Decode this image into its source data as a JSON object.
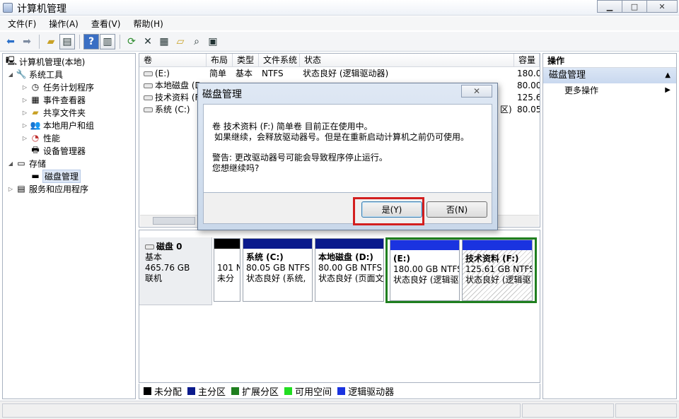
{
  "window": {
    "title": "计算机管理",
    "minimize": "▁",
    "maximize": "□",
    "close": "✕"
  },
  "menu": [
    "文件(F)",
    "操作(A)",
    "查看(V)",
    "帮助(H)"
  ],
  "toolbar_icons": [
    "back-arrow-icon",
    "forward-arrow-icon",
    "up-folder-icon",
    "show-tree-icon",
    "help-icon",
    "show-action-pane-icon",
    "refresh-icon",
    "delete-icon",
    "properties-icon",
    "open-icon",
    "search-icon",
    "disk-settings-icon"
  ],
  "tree": {
    "root": "计算机管理(本地)",
    "system_tools": "系统工具",
    "task_scheduler": "任务计划程序",
    "event_viewer": "事件查看器",
    "shared_folders": "共享文件夹",
    "local_users": "本地用户和组",
    "performance": "性能",
    "device_manager": "设备管理器",
    "storage": "存储",
    "disk_management": "磁盘管理",
    "services_apps": "服务和应用程序"
  },
  "volumes": {
    "headers": [
      "卷",
      "布局",
      "类型",
      "文件系统",
      "状态",
      "容量"
    ],
    "rows": [
      [
        "(E:)",
        "简单",
        "基本",
        "NTFS",
        "状态良好 (逻辑驱动器)",
        "180.0"
      ],
      [
        "本地磁盘 (D:",
        "",
        "",
        "",
        "",
        "80.00"
      ],
      [
        "技术资料 (F",
        "",
        "",
        "",
        "",
        "125.6"
      ],
      [
        "系统 (C:)",
        "",
        "",
        "",
        "区)",
        "80.05"
      ]
    ]
  },
  "disk": {
    "name": "磁盘 0",
    "type": "基本",
    "size": "465.76 GB",
    "status": "联机",
    "partitions": [
      {
        "title": "",
        "line1": "101 N",
        "line2": "未分",
        "color": "#000000"
      },
      {
        "title": "系统 (C:)",
        "line1": "80.05 GB NTFS",
        "line2": "状态良好 (系统,",
        "color": "#0a1a8c"
      },
      {
        "title": "本地磁盘 (D:)",
        "line1": "80.00 GB NTFS",
        "line2": "状态良好 (页面文",
        "color": "#0a1a8c"
      },
      {
        "title": "(E:)",
        "line1": "180.00 GB NTFS",
        "line2": "状态良好 (逻辑驱",
        "color": "#1a33e0"
      },
      {
        "title": "技术资料 (F:)",
        "line1": "125.61 GB NTFS",
        "line2": "状态良好 (逻辑驱",
        "color": "#1a33e0"
      }
    ]
  },
  "legend": [
    {
      "label": "未分配",
      "color": "#000000"
    },
    {
      "label": "主分区",
      "color": "#0a1a8c"
    },
    {
      "label": "扩展分区",
      "color": "#1f7f1f"
    },
    {
      "label": "可用空间",
      "color": "#22dd22"
    },
    {
      "label": "逻辑驱动器",
      "color": "#1a33e0"
    }
  ],
  "actions": {
    "title": "操作",
    "section": "磁盘管理",
    "more": "更多操作"
  },
  "dialog": {
    "title": "磁盘管理",
    "close": "✕",
    "line1": "卷 技术资料 (F:) 简单卷 目前正在使用中。",
    "line2": "如果继续，会释放驱动器号。但是在重新启动计算机之前仍可使用。",
    "line3": "警告: 更改驱动器号可能会导致程序停止运行。",
    "line4": "您想继续吗?",
    "yes": "是(Y)",
    "no": "否(N)"
  }
}
